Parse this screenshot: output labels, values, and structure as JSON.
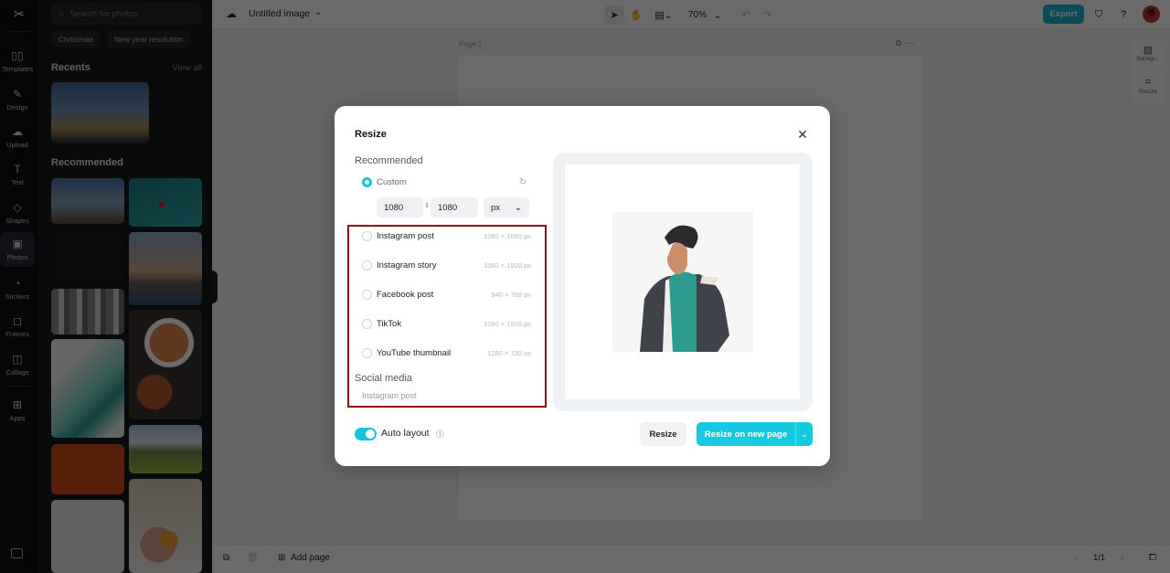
{
  "rail": {
    "logo": "CapCut",
    "items": [
      {
        "label": "Templates",
        "icon": "templates-icon",
        "glyph": "▯▯"
      },
      {
        "label": "Design",
        "icon": "design-icon",
        "glyph": "✎"
      },
      {
        "label": "Upload",
        "icon": "upload-icon",
        "glyph": "☁"
      },
      {
        "label": "Text",
        "icon": "text-icon",
        "glyph": "T"
      },
      {
        "label": "Shapes",
        "icon": "shapes-icon",
        "glyph": "◇"
      },
      {
        "label": "Photos",
        "icon": "photos-icon",
        "glyph": "▣"
      },
      {
        "label": "Stickers",
        "icon": "stickers-icon",
        "glyph": "◔"
      },
      {
        "label": "Frames",
        "icon": "frames-icon",
        "glyph": "◻"
      },
      {
        "label": "Collage",
        "icon": "collage-icon",
        "glyph": "◫"
      },
      {
        "label": "Apps",
        "icon": "apps-icon",
        "glyph": "⊞"
      }
    ]
  },
  "panel": {
    "search_placeholder": "Search for photos",
    "chips": [
      "Christmas",
      "New year resolution"
    ],
    "recents_title": "Recents",
    "view_all": "View all",
    "recommended_title": "Recommended"
  },
  "topbar": {
    "doc_title": "Untitled image",
    "zoom": "70%",
    "export_label": "Export"
  },
  "canvas": {
    "page_label": "Page 1"
  },
  "side_tools": [
    {
      "label": "Backgr...",
      "icon": "background-icon"
    },
    {
      "label": "Resize",
      "icon": "resize-icon"
    }
  ],
  "bottombar": {
    "add_page": "Add page",
    "page_counter": "1/1"
  },
  "modal": {
    "title": "Resize",
    "recommended_title": "Recommended",
    "custom_label": "Custom",
    "width_value": "1080",
    "height_value": "1080",
    "unit": "px",
    "presets": [
      {
        "label": "Instagram post",
        "dims": "1080 × 1080 px"
      },
      {
        "label": "Instagram story",
        "dims": "1080 × 1920 px"
      },
      {
        "label": "Facebook post",
        "dims": "940 × 788 px"
      },
      {
        "label": "TikTok",
        "dims": "1080 × 1920 px"
      },
      {
        "label": "YouTube thumbnail",
        "dims": "1280 × 720 px"
      }
    ],
    "social_media_title": "Social media",
    "social_first_item": "Instagram post",
    "auto_layout_label": "Auto layout",
    "auto_layout_on": true,
    "resize_button": "Resize",
    "resize_new_page_button": "Resize on new page"
  },
  "colors": {
    "accent": "#15c9e0",
    "export": "#1bb1cc",
    "highlight": "#8b0a17"
  }
}
